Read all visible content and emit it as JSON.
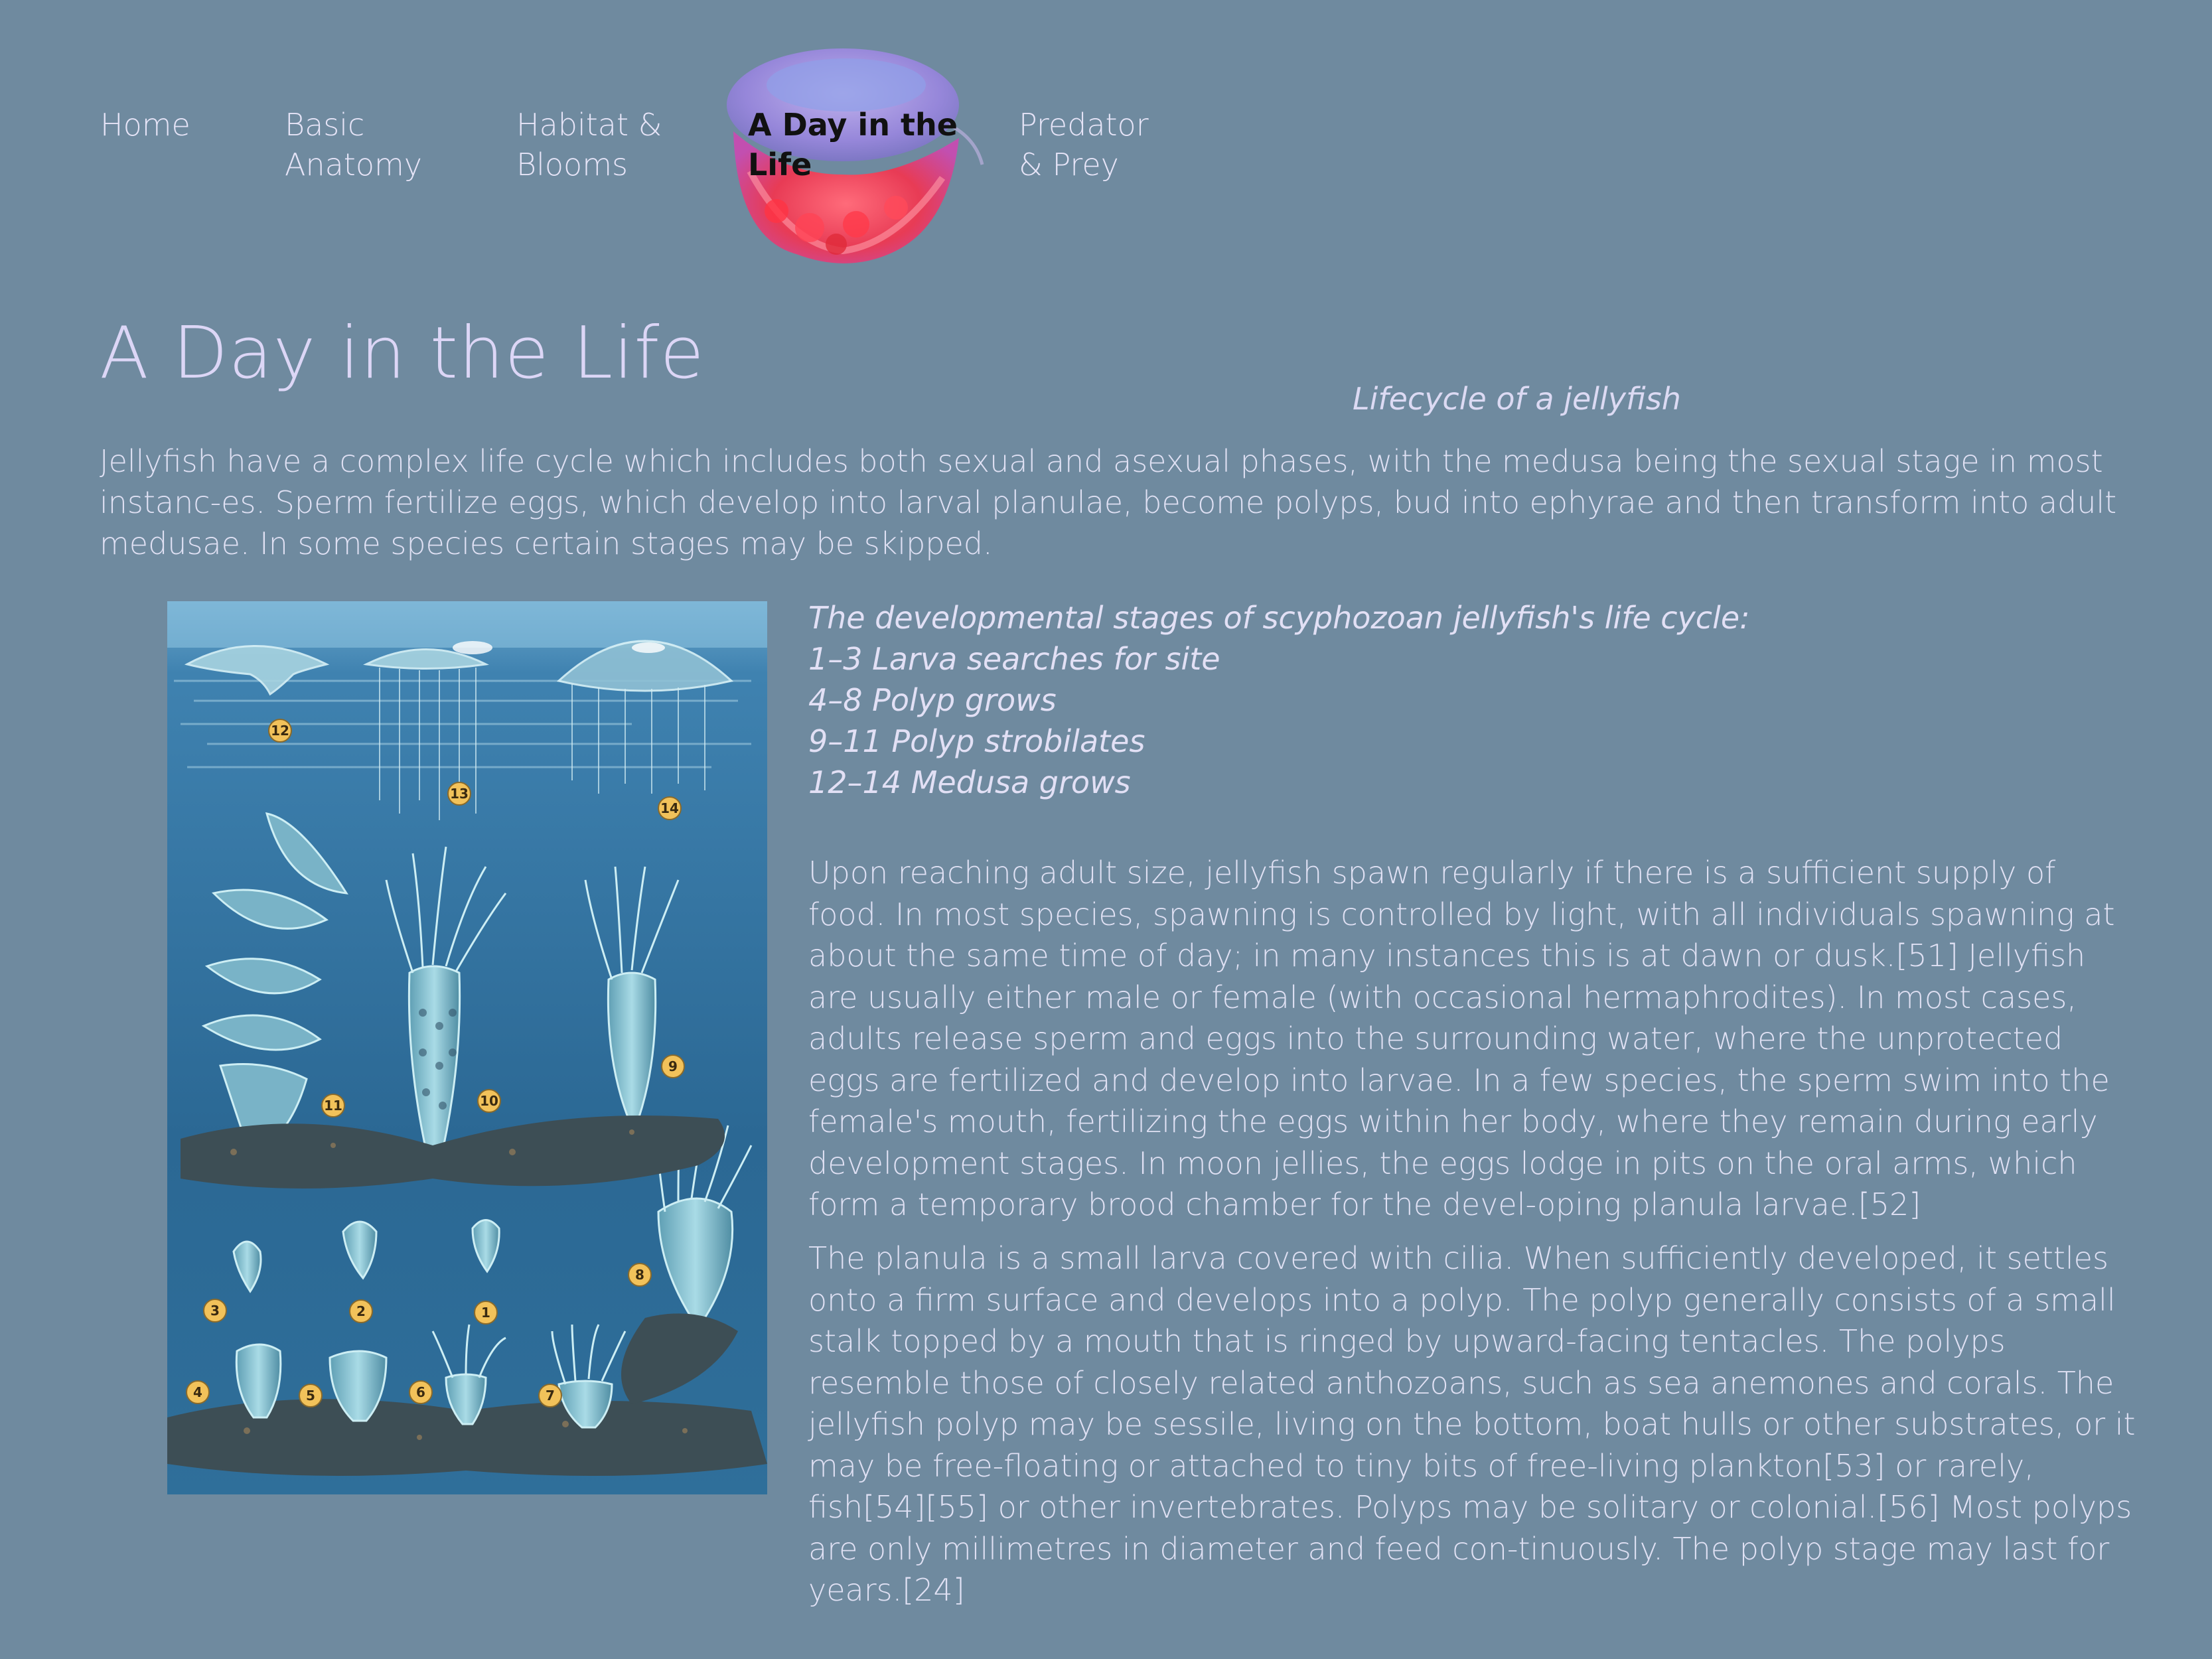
{
  "nav": {
    "home": "Home",
    "anatomy": "Basic\nAnatomy",
    "habitat": "Habitat &\nBlooms",
    "active": "A Day in the\nLife",
    "predator": "Predator\n& Prey"
  },
  "page": {
    "title": "A Day in the Life",
    "caption_title": "Lifecycle of a jellyfish",
    "intro": "Jellyfish have a complex life cycle which includes both sexual and asexual phases, with the medusa being the sexual stage in most instanc-es. Sperm fertilize eggs, which develop into larval planulae, become polyps, bud into ephyrae and then transform into adult medusae. In some species certain stages may be skipped."
  },
  "figure": {
    "stage_numbers": [
      "12",
      "13",
      "14",
      "11",
      "10",
      "9",
      "3",
      "2",
      "1",
      "8",
      "4",
      "5",
      "6",
      "7"
    ]
  },
  "stages": {
    "heading": "The developmental stages of scyphozoan jellyfish's life cycle:",
    "items": [
      "1–3 Larva searches for site",
      "4–8 Polyp grows",
      "9–11 Polyp strobilates",
      "12–14 Medusa grows"
    ]
  },
  "body": {
    "para1": "Upon reaching adult size, jellyfish spawn regularly if there is a sufficient supply of food. In most species, spawning is controlled by light, with all individuals spawning at about the same time of day; in many instances this is at dawn or dusk.[51] Jellyfish are usually either male or female (with occasional hermaphrodites). In most cases, adults release sperm and eggs into the surrounding water, where the unprotected eggs are fertilized and develop into larvae. In a few species, the sperm swim into the female's mouth, fertilizing the eggs within her body, where they remain during early development stages. In moon jellies, the eggs lodge in pits on the oral arms, which form a temporary brood chamber for the devel-oping planula larvae.[52]",
    "para2": "The planula is a small larva covered with cilia. When sufficiently developed, it settles onto a firm surface and develops into a polyp. The polyp generally consists of a small stalk topped by a mouth that is ringed by upward-facing tentacles. The polyps resemble those of closely related anthozoans, such as sea anemones and corals. The jellyfish polyp may be sessile, living on the bottom, boat hulls or other substrates, or it may be free-floating or attached to tiny bits of free-living plankton[53] or rarely, fish[54][55] or other invertebrates. Polyps may be solitary or colonial.[56] Most polyps are only millimetres in diameter and feed con-tinuously. The polyp stage may last for years.[24]"
  },
  "colors": {
    "background": "#6f8a9f",
    "title": "#dcd6f6",
    "figure_water": "#2f6f9a",
    "stage_badge": "#f2c25a"
  }
}
